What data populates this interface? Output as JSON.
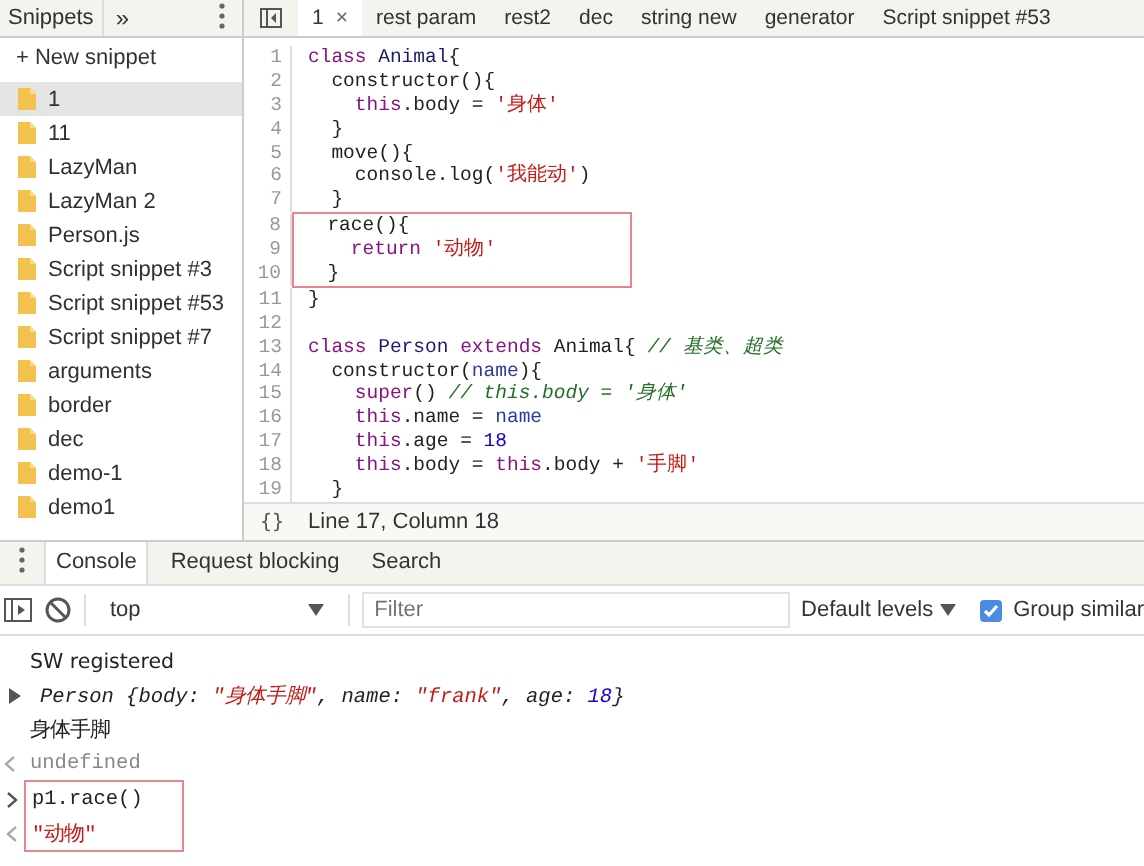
{
  "sidebar": {
    "title": "Snippets",
    "more": "»",
    "new_snippet": "+ New snippet",
    "items": [
      {
        "label": "1",
        "selected": true
      },
      {
        "label": "11",
        "selected": false
      },
      {
        "label": "LazyMan",
        "selected": false
      },
      {
        "label": "LazyMan 2",
        "selected": false
      },
      {
        "label": "Person.js",
        "selected": false
      },
      {
        "label": "Script snippet #3",
        "selected": false
      },
      {
        "label": "Script snippet #53",
        "selected": false
      },
      {
        "label": "Script snippet #7",
        "selected": false
      },
      {
        "label": "arguments",
        "selected": false
      },
      {
        "label": "border",
        "selected": false
      },
      {
        "label": "dec",
        "selected": false
      },
      {
        "label": "demo-1",
        "selected": false
      },
      {
        "label": "demo1",
        "selected": false
      }
    ]
  },
  "editor": {
    "tabs": [
      {
        "label": "1",
        "close": "×",
        "selected": true
      },
      {
        "label": "rest param",
        "selected": false
      },
      {
        "label": "rest2",
        "selected": false
      },
      {
        "label": "dec",
        "selected": false
      },
      {
        "label": "string new",
        "selected": false
      },
      {
        "label": "generator",
        "selected": false
      },
      {
        "label": "Script snippet #53",
        "selected": false
      }
    ],
    "lines": [
      {
        "number": "1",
        "boxed": false,
        "segments": [
          {
            "kind": "kw",
            "text": "class "
          },
          {
            "kind": "def",
            "text": "Animal"
          },
          {
            "kind": "plain",
            "text": "{"
          }
        ]
      },
      {
        "number": "2",
        "boxed": false,
        "segments": [
          {
            "kind": "plain",
            "text": "  constructor(){"
          }
        ]
      },
      {
        "number": "3",
        "boxed": false,
        "segments": [
          {
            "kind": "kw",
            "text": "    this"
          },
          {
            "kind": "plain",
            "text": ".body = "
          },
          {
            "kind": "str",
            "text": "'身体'"
          }
        ]
      },
      {
        "number": "4",
        "boxed": false,
        "segments": [
          {
            "kind": "plain",
            "text": "  }"
          }
        ]
      },
      {
        "number": "5",
        "boxed": false,
        "segments": [
          {
            "kind": "plain",
            "text": "  move(){"
          }
        ]
      },
      {
        "number": "6",
        "boxed": false,
        "segments": [
          {
            "kind": "plain",
            "text": "    console.log("
          },
          {
            "kind": "str",
            "text": "'我能动'"
          },
          {
            "kind": "plain",
            "text": ")"
          }
        ]
      },
      {
        "number": "7",
        "boxed": false,
        "segments": [
          {
            "kind": "plain",
            "text": "  }"
          }
        ]
      },
      {
        "number": "8",
        "boxed": true,
        "segments": [
          {
            "kind": "plain",
            "text": "  race(){"
          }
        ]
      },
      {
        "number": "9",
        "boxed": true,
        "segments": [
          {
            "kind": "kw",
            "text": "    return "
          },
          {
            "kind": "str",
            "text": "'动物'"
          }
        ]
      },
      {
        "number": "10",
        "boxed": true,
        "segments": [
          {
            "kind": "plain",
            "text": "  }"
          }
        ]
      },
      {
        "number": "11",
        "boxed": false,
        "segments": [
          {
            "kind": "plain",
            "text": "}"
          }
        ]
      },
      {
        "number": "12",
        "boxed": false
      },
      {
        "number": "13",
        "boxed": false,
        "segments": [
          {
            "kind": "kw",
            "text": "class "
          },
          {
            "kind": "def",
            "text": "Person "
          },
          {
            "kind": "kw",
            "text": "extends "
          },
          {
            "kind": "plain",
            "text": "Animal{ "
          },
          {
            "kind": "cmt",
            "text": "// 基类、超类"
          }
        ]
      },
      {
        "number": "14",
        "boxed": false,
        "segments": [
          {
            "kind": "plain",
            "text": "  constructor("
          },
          {
            "kind": "var",
            "text": "name"
          },
          {
            "kind": "plain",
            "text": "){"
          }
        ]
      },
      {
        "number": "15",
        "boxed": false,
        "segments": [
          {
            "kind": "kw",
            "text": "    super"
          },
          {
            "kind": "plain",
            "text": "() "
          },
          {
            "kind": "cmt",
            "text": "// this.body = '身体'"
          }
        ]
      },
      {
        "number": "16",
        "boxed": false,
        "segments": [
          {
            "kind": "kw",
            "text": "    this"
          },
          {
            "kind": "plain",
            "text": ".name = "
          },
          {
            "kind": "var",
            "text": "name"
          }
        ]
      },
      {
        "number": "17",
        "boxed": false,
        "segments": [
          {
            "kind": "kw",
            "text": "    this"
          },
          {
            "kind": "plain",
            "text": ".age = "
          },
          {
            "kind": "num",
            "text": "18"
          }
        ]
      },
      {
        "number": "18",
        "boxed": false,
        "segments": [
          {
            "kind": "kw",
            "text": "    this"
          },
          {
            "kind": "plain",
            "text": ".body = "
          },
          {
            "kind": "kw",
            "text": "this"
          },
          {
            "kind": "plain",
            "text": ".body + "
          },
          {
            "kind": "str",
            "text": "'手脚'"
          }
        ]
      },
      {
        "number": "19",
        "boxed": false,
        "segments": [
          {
            "kind": "plain",
            "text": "  }"
          }
        ]
      }
    ],
    "status": {
      "braces": "{}",
      "position": "Line 17, Column 18"
    }
  },
  "drawer": {
    "tabs": [
      {
        "label": "Console",
        "selected": true
      },
      {
        "label": "Request blocking",
        "selected": false
      },
      {
        "label": "Search",
        "selected": false
      }
    ]
  },
  "console": {
    "context": "top",
    "filter": {
      "placeholder": "Filter"
    },
    "levels": "Default levels",
    "group_similar": {
      "label": "Group similar",
      "checked": true
    },
    "messages": [
      {
        "kind": "log",
        "boxed": false,
        "segments": [
          {
            "kind": "plain",
            "text": "SW registered"
          }
        ]
      },
      {
        "kind": "object",
        "boxed": false,
        "expanded": false,
        "segments": [
          {
            "kind": "plain",
            "text": "Person {body: "
          },
          {
            "kind": "str",
            "text": "\"身体手脚\""
          },
          {
            "kind": "plain",
            "text": ", name: "
          },
          {
            "kind": "str",
            "text": "\"frank\""
          },
          {
            "kind": "plain",
            "text": ", age: "
          },
          {
            "kind": "num",
            "text": "18"
          },
          {
            "kind": "plain",
            "text": "}"
          }
        ]
      },
      {
        "kind": "log",
        "boxed": false,
        "segments": [
          {
            "kind": "plain",
            "text": "身体手脚"
          }
        ]
      },
      {
        "kind": "result",
        "boxed": false,
        "segments": [
          {
            "kind": "undef",
            "text": "undefined"
          }
        ]
      },
      {
        "kind": "input",
        "boxed": true,
        "segments": [
          {
            "kind": "plain",
            "text": "p1.race()"
          }
        ]
      },
      {
        "kind": "result",
        "boxed": true,
        "segments": [
          {
            "kind": "str",
            "text": "\"动物\""
          }
        ]
      }
    ]
  }
}
